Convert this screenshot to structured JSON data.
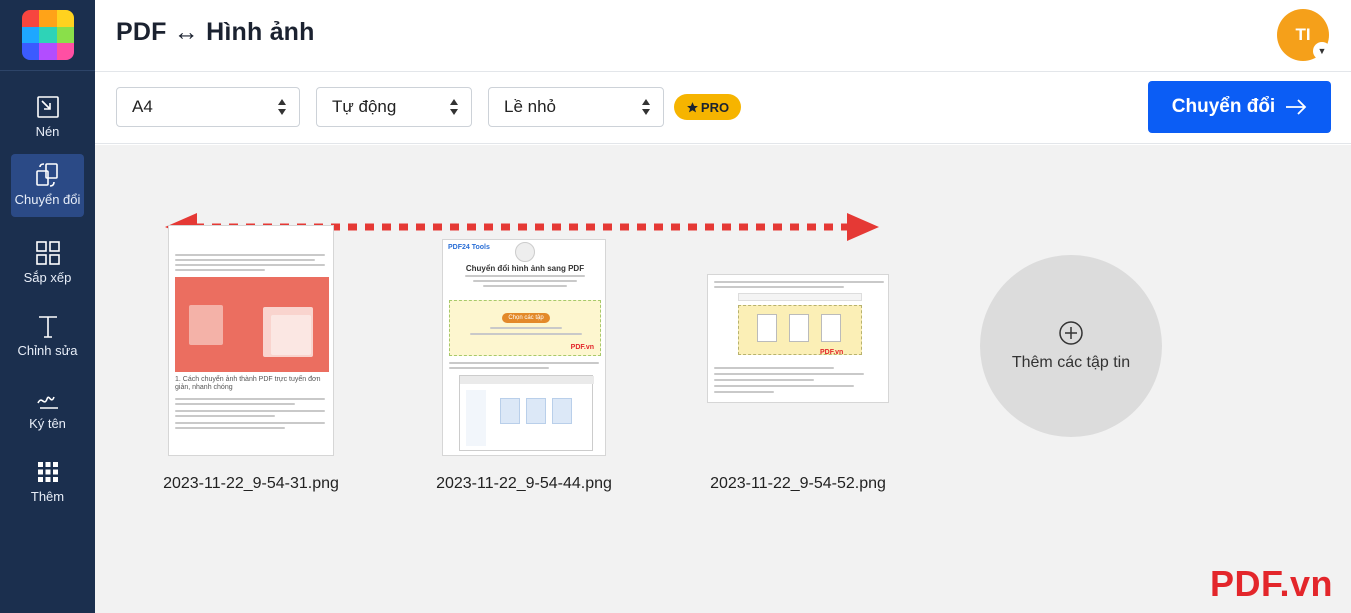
{
  "app": {
    "title": "PDF ↔ Hình ảnh",
    "avatar_initials": "TI"
  },
  "sidebar": {
    "items": [
      {
        "label": "Nén",
        "icon": "compress-icon",
        "active": false
      },
      {
        "label": "Chuyển đổi",
        "icon": "convert-icon",
        "active": true
      },
      {
        "label": "Sắp xếp",
        "icon": "grid-icon",
        "active": false
      },
      {
        "label": "Chỉnh sửa",
        "icon": "text-edit-icon",
        "active": false
      },
      {
        "label": "Ký tên",
        "icon": "signature-icon",
        "active": false
      },
      {
        "label": "Thêm",
        "icon": "more-dots-icon",
        "active": false
      }
    ]
  },
  "toolbar": {
    "page_size": "A4",
    "orientation": "Tự động",
    "margin": "Lề nhỏ",
    "pro_label": "PRO",
    "convert_label": "Chuyển đổi"
  },
  "files": [
    {
      "name": "2023-11-22_9-54-31.png"
    },
    {
      "name": "2023-11-22_9-54-44.png"
    },
    {
      "name": "2023-11-22_9-54-52.png"
    }
  ],
  "add_files_label": "Thêm các tập tin",
  "thumb2": {
    "brand": "PDF24 Tools",
    "heading": "Chuyển đổi hình ảnh sang PDF",
    "button": "Chọn các tập"
  },
  "thumb1": {
    "heading": "1. Cách chuyển ảnh thành PDF trực tuyến đơn giản, nhanh chóng"
  },
  "watermark": "PDF.vn",
  "colors": {
    "sidebar_bg": "#1b2f4e",
    "accent": "#0b5df5",
    "pro_badge": "#f6b400",
    "avatar": "#f5a01a",
    "arrow": "#e53935"
  }
}
